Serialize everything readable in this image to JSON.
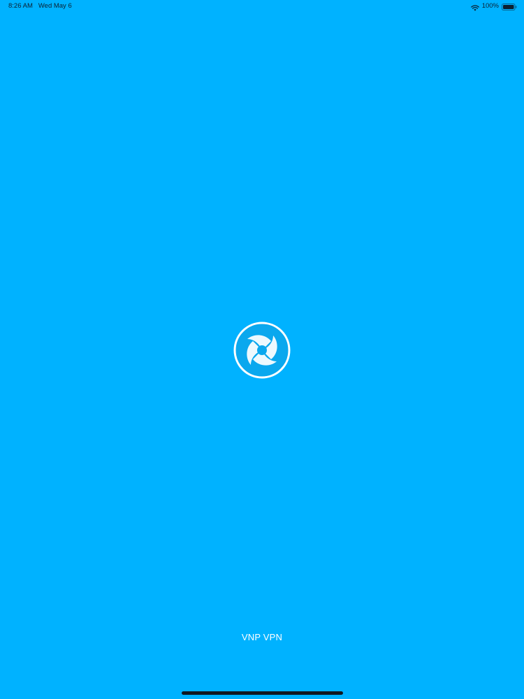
{
  "status_bar": {
    "time": "8:26 AM",
    "date": "Wed May 6",
    "battery": "100%",
    "icons": [
      "wifi-icon",
      "battery-icon"
    ]
  },
  "splash": {
    "logo_icon": "swirl-logo-icon",
    "app_name": "VNP VPN"
  },
  "colors": {
    "background": "#00b2ff",
    "logo_fill": "#0aa8ee",
    "foreground": "#ffffff",
    "status_text": "#0c2030"
  }
}
